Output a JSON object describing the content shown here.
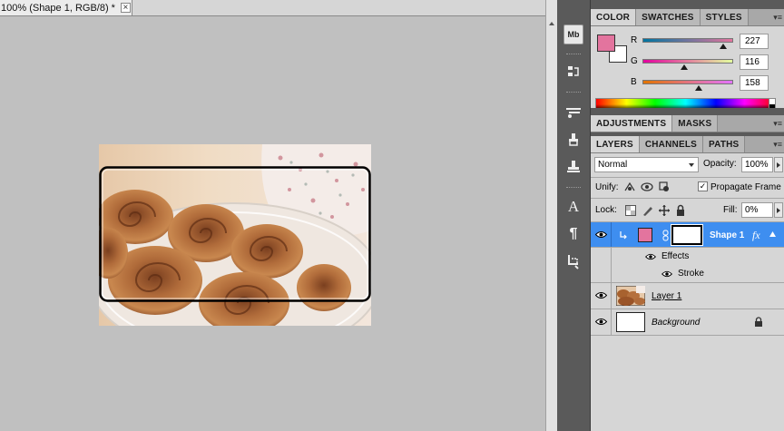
{
  "document": {
    "tab_title": "100% (Shape 1, RGB/8) *",
    "close_glyph": "×"
  },
  "dock": {
    "items": [
      {
        "name": "mini-bridge",
        "label": "Mb"
      },
      {
        "name": "history"
      },
      {
        "name": "brush-presets"
      },
      {
        "name": "clone-source"
      },
      {
        "name": "tool-presets"
      },
      {
        "name": "character",
        "label": "A"
      },
      {
        "name": "paragraph",
        "label": "¶"
      },
      {
        "name": "notes"
      }
    ]
  },
  "color_panel": {
    "tabs": [
      "COLOR",
      "SWATCHES",
      "STYLES"
    ],
    "active_tab": "COLOR",
    "foreground": "#e3749e",
    "background": "#ffffff",
    "channels": [
      {
        "label": "R",
        "value": "227",
        "fraction": 0.89
      },
      {
        "label": "G",
        "value": "116",
        "fraction": 0.455
      },
      {
        "label": "B",
        "value": "158",
        "fraction": 0.62
      }
    ]
  },
  "adjustments_panel": {
    "tabs": [
      "ADJUSTMENTS",
      "MASKS"
    ],
    "active_tab": "ADJUSTMENTS"
  },
  "layers_panel": {
    "tabs": [
      "LAYERS",
      "CHANNELS",
      "PATHS"
    ],
    "active_tab": "LAYERS",
    "blend_mode": "Normal",
    "opacity_label": "Opacity:",
    "opacity_value": "100%",
    "unify_label": "Unify:",
    "propagate_label": "Propagate Frame",
    "propagate_checked": "✓",
    "lock_label": "Lock:",
    "fill_label": "Fill:",
    "fill_value": "0%",
    "layers": [
      {
        "name": "Shape 1",
        "fx": "fx",
        "selected": true,
        "swatch": "#e3749e"
      },
      {
        "name": "Effects"
      },
      {
        "name": "Stroke"
      },
      {
        "name": "Layer 1"
      },
      {
        "name": "Background"
      }
    ]
  },
  "colors": {
    "selection": "#3e8ef0",
    "panel": "#d6d6d6",
    "dock": "#5a5a5a",
    "workspace": "#c0c0c0"
  }
}
